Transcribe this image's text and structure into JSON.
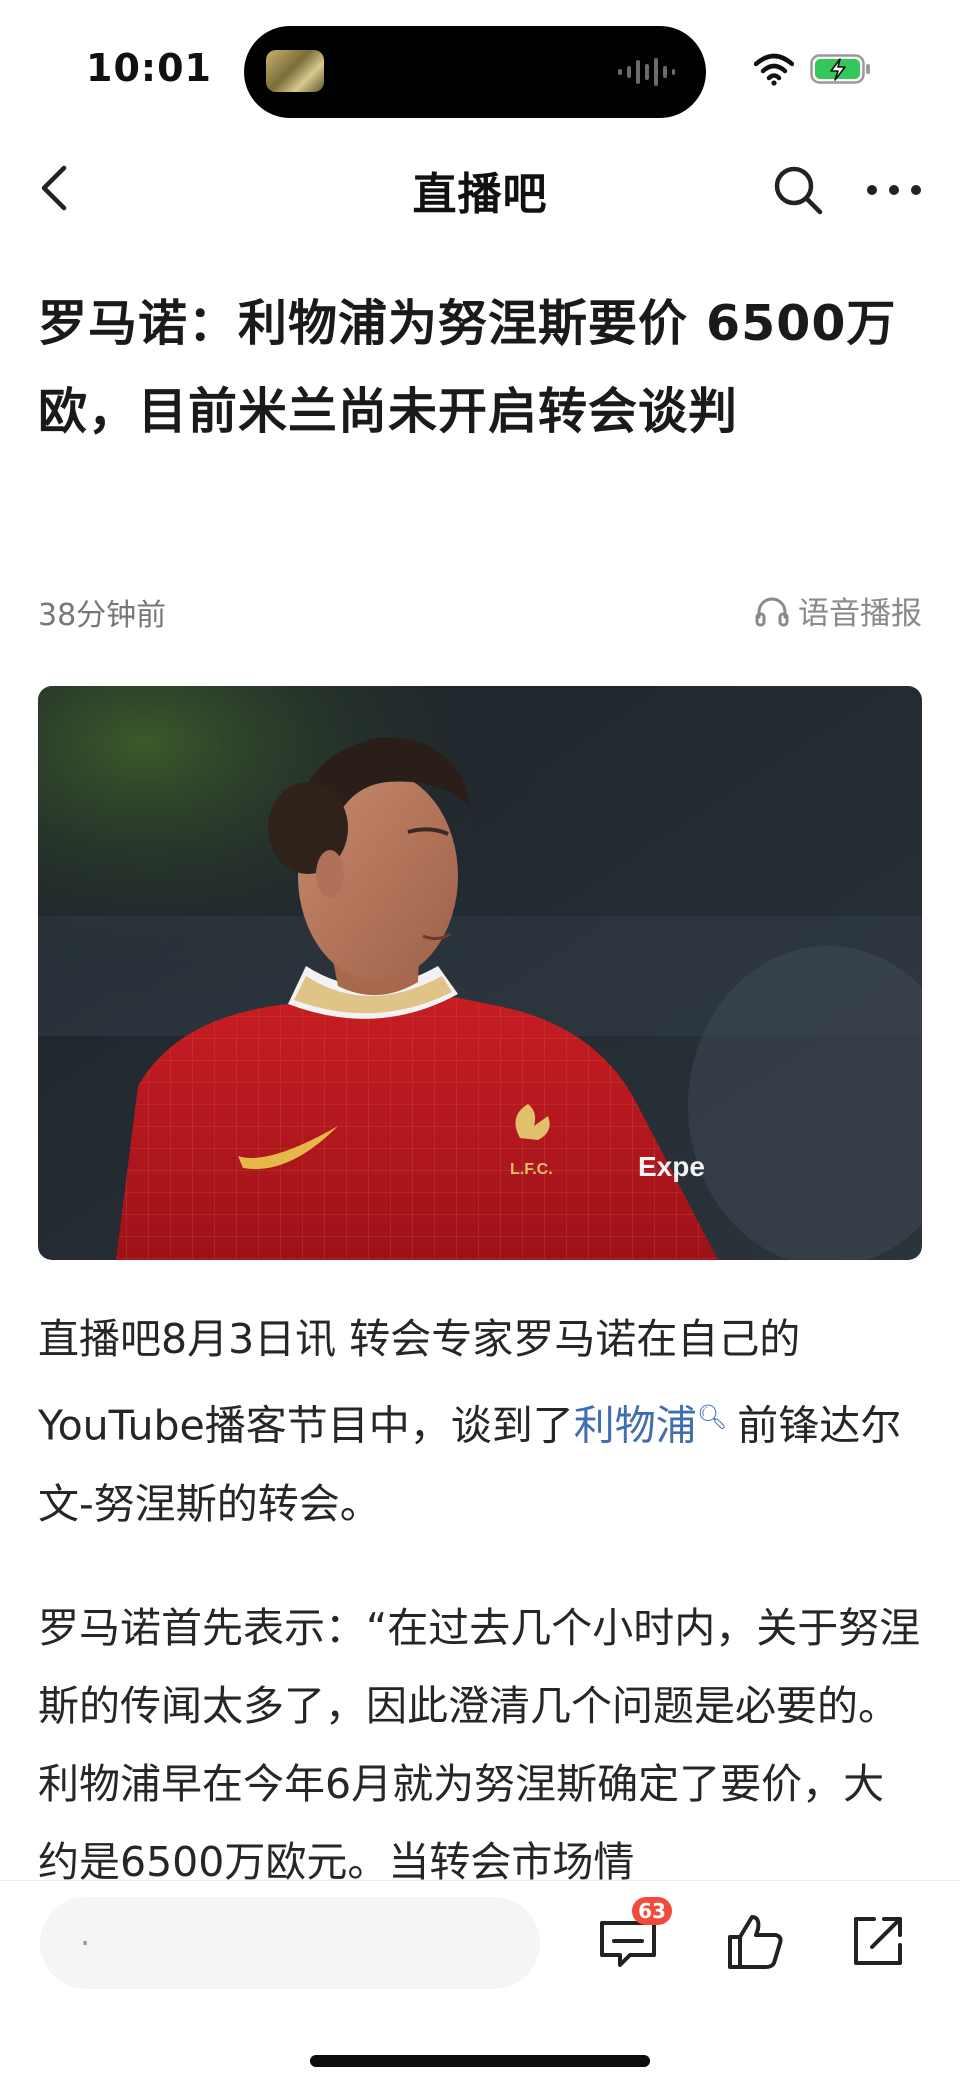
{
  "status_bar": {
    "time": "10:01"
  },
  "nav": {
    "title": "直播吧",
    "back_icon": "chevron-left-icon",
    "search_icon": "search-icon",
    "more_icon": "more-dots-icon"
  },
  "article": {
    "title": "罗马诺：利物浦为努涅斯要价 6500万欧，目前米兰尚未开启转会谈判",
    "time_ago": "38分钟前",
    "audio_label": "语音播报",
    "image_alt_icon": "player-photo",
    "paragraph1": {
      "before_link": "直播吧8月3日讯  转会专家罗马诺在自己的YouTube播客节目中，谈到了",
      "link": "利物浦",
      "after_link": "前锋达尔文-努涅斯的转会。"
    },
    "paragraph2": "罗马诺首先表示：“在过去几个小时内，关于努涅斯的传闻太多了，因此澄清几个问题是必要的。利物浦早在今年6月就为努涅斯确定了要价，大约是6500万欧元。当转会市场情"
  },
  "bottom_bar": {
    "comment_placeholder": "·",
    "comment_count": "63",
    "icons": [
      "comment-icon",
      "thumbs-up-icon",
      "share-icon"
    ]
  },
  "colors": {
    "link": "#3f6eb2",
    "badge": "#f24a3d",
    "kit_red": "#c0171f"
  }
}
